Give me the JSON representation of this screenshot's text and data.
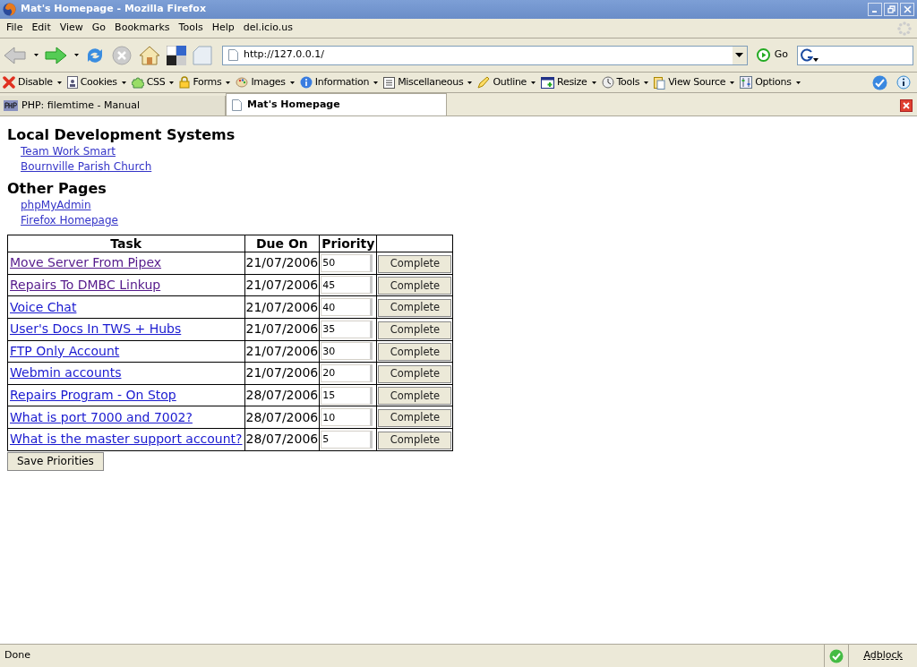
{
  "window": {
    "title": "Mat's Homepage - Mozilla Firefox"
  },
  "menu": [
    "File",
    "Edit",
    "View",
    "Go",
    "Bookmarks",
    "Tools",
    "Help",
    "del.icio.us"
  ],
  "navigation": {
    "url": "http://127.0.0.1/",
    "go_label": "Go"
  },
  "dev_toolbar": [
    "Disable",
    "Cookies",
    "CSS",
    "Forms",
    "Images",
    "Information",
    "Miscellaneous",
    "Outline",
    "Resize",
    "Tools",
    "View Source",
    "Options"
  ],
  "tabs": [
    {
      "label": "PHP: filemtime - Manual",
      "selected": false
    },
    {
      "label": "Mat's Homepage",
      "selected": true
    }
  ],
  "sections": [
    {
      "heading": "Local Development Systems",
      "links": [
        "Team Work Smart",
        "Bournville Parish Church"
      ]
    },
    {
      "heading": "Other Pages",
      "links": [
        "phpMyAdmin",
        "Firefox Homepage"
      ]
    }
  ],
  "table": {
    "columns": [
      "Task",
      "Due On",
      "Priority"
    ],
    "rows": [
      {
        "task": "Move Server From Pipex",
        "visited": true,
        "due": "21/07/2006",
        "priority": "50",
        "action": "Complete"
      },
      {
        "task": "Repairs To DMBC Linkup",
        "visited": true,
        "due": "21/07/2006",
        "priority": "45",
        "action": "Complete"
      },
      {
        "task": "Voice Chat",
        "visited": false,
        "due": "21/07/2006",
        "priority": "40",
        "action": "Complete"
      },
      {
        "task": "User's Docs In TWS + Hubs",
        "visited": false,
        "due": "21/07/2006",
        "priority": "35",
        "action": "Complete"
      },
      {
        "task": "FTP Only Account",
        "visited": false,
        "due": "21/07/2006",
        "priority": "30",
        "action": "Complete"
      },
      {
        "task": "Webmin accounts",
        "visited": false,
        "due": "21/07/2006",
        "priority": "20",
        "action": "Complete"
      },
      {
        "task": "Repairs Program - On Stop",
        "visited": false,
        "due": "28/07/2006",
        "priority": "15",
        "action": "Complete"
      },
      {
        "task": "What is port 7000 and 7002?",
        "visited": false,
        "due": "28/07/2006",
        "priority": "10",
        "action": "Complete"
      },
      {
        "task": "What is the master support account?",
        "visited": false,
        "due": "28/07/2006",
        "priority": "5",
        "action": "Complete"
      }
    ]
  },
  "save_button": "Save Priorities",
  "status_bar": {
    "text": "Done",
    "adblock": "Adblock"
  }
}
